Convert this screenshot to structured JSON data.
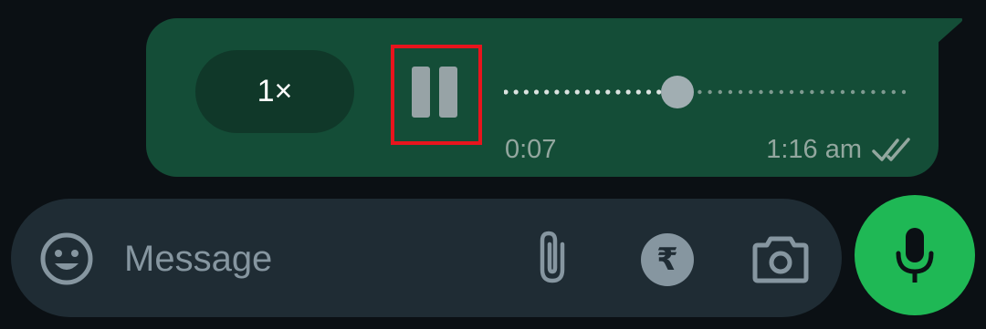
{
  "voice_message": {
    "playback_speed": "1×",
    "elapsed": "0:07",
    "sent_time": "1:16 am",
    "progress": 0.41,
    "state": "playing",
    "read_status": "read",
    "pause_icon": "pause-icon",
    "ticks_icon": "double-check-icon"
  },
  "composer": {
    "placeholder": "Message",
    "value": "",
    "emoji_icon": "emoji-icon",
    "attach_icon": "paperclip-icon",
    "payment_symbol": "₹",
    "camera_icon": "camera-icon",
    "mic_icon": "microphone-icon"
  },
  "colors": {
    "bubble": "#144d37",
    "mic_button": "#1fb855",
    "highlight": "#e8141d",
    "compose_bar": "#1f2c34"
  }
}
